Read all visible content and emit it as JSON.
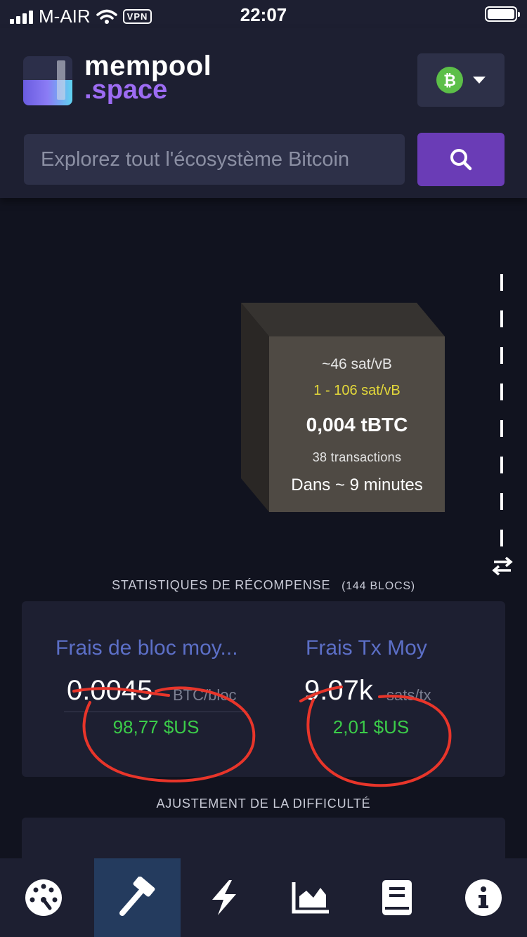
{
  "status_bar": {
    "carrier": "M-AIR",
    "vpn": "VPN",
    "time": "22:07"
  },
  "header": {
    "logo_line1": "mempool",
    "logo_line2": ".space",
    "network_icon": "bitcoin-icon",
    "search_placeholder": "Explorez tout l'écosystème Bitcoin",
    "search_icon": "search-icon"
  },
  "mempool_block": {
    "median_fee": "~46 sat/vB",
    "fee_range": "1 - 106 sat/vB",
    "total": "0,004 tBTC",
    "transactions": "38 transactions",
    "eta": "Dans ~ 9 minutes"
  },
  "reward_stats": {
    "title": "STATISTIQUES DE RÉCOMPENSE",
    "subtitle": "(144 BLOCS)",
    "avg_block_fees": {
      "label": "Frais de bloc moy...",
      "value": "0.0045",
      "unit": "BTC/bloc",
      "fiat": "98,77 $US"
    },
    "avg_tx_fees": {
      "label": "Frais Tx Moy",
      "value": "9.07k",
      "unit": "sats/tx",
      "fiat": "2,01 $US"
    }
  },
  "difficulty": {
    "title": "AJUSTEMENT DE LA DIFFICULTÉ"
  },
  "bottom_nav": {
    "active": "mining",
    "items": [
      "dashboard-icon",
      "hammer-icon",
      "lightning-icon",
      "chart-icon",
      "book-icon",
      "info-icon"
    ]
  },
  "colors": {
    "accent": "#6a3cb6",
    "label_blue": "#5c6fc7",
    "fiat_green": "#3bcc49",
    "annotation_red": "#e8352a"
  }
}
